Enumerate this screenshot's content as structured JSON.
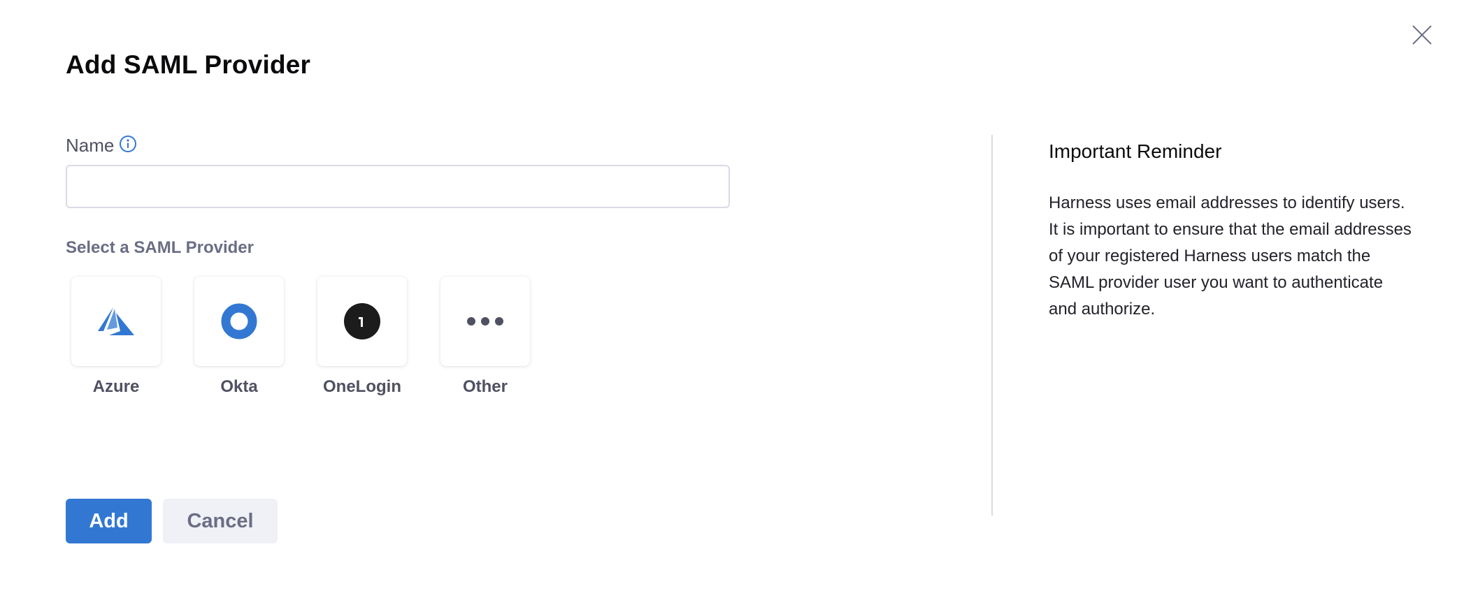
{
  "dialog": {
    "title": "Add SAML Provider",
    "close_icon": "close-icon"
  },
  "form": {
    "name_label": "Name",
    "name_value": "",
    "name_placeholder": "",
    "info_icon": "info-icon",
    "select_label": "Select a SAML Provider",
    "providers": [
      {
        "label": "Azure",
        "icon": "azure-icon",
        "color": "#3278d2"
      },
      {
        "label": "Okta",
        "icon": "okta-icon",
        "color": "#3278d2"
      },
      {
        "label": "OneLogin",
        "icon": "onelogin-icon",
        "color": "#1c1c1c"
      },
      {
        "label": "Other",
        "icon": "more-dots-icon",
        "color": "#4f5162"
      }
    ]
  },
  "actions": {
    "add_label": "Add",
    "cancel_label": "Cancel"
  },
  "reminder": {
    "title": "Important Reminder",
    "body": "Harness uses email addresses to identify users. It is important to ensure that the email addresses of your registered Harness users match the SAML provider user you want to authenticate and authorize."
  },
  "colors": {
    "primary": "#3278d2",
    "secondary_bg": "#f0f1f6",
    "muted_text": "#6b6d85",
    "border": "#d9dae5"
  }
}
